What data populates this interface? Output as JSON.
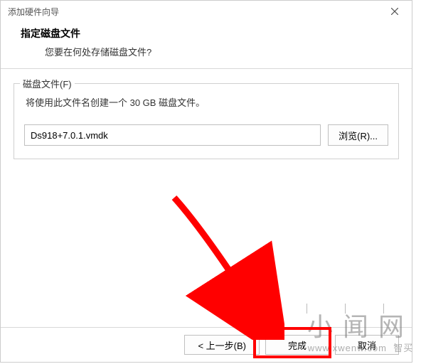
{
  "window": {
    "title": "添加硬件向导"
  },
  "header": {
    "title": "指定磁盘文件",
    "subtitle": "您要在何处存储磁盘文件?"
  },
  "fieldset": {
    "legend": "磁盘文件(F)",
    "description": "将使用此文件名创建一个 30 GB 磁盘文件。",
    "filename": "Ds918+7.0.1.vmdk",
    "browse": "浏览(R)..."
  },
  "footer": {
    "back": "< 上一步(B)",
    "finish": "完成",
    "cancel": "取消"
  },
  "watermark": {
    "brand": "小闻网",
    "url": "www.xwenw.com",
    "extra": "智买"
  }
}
